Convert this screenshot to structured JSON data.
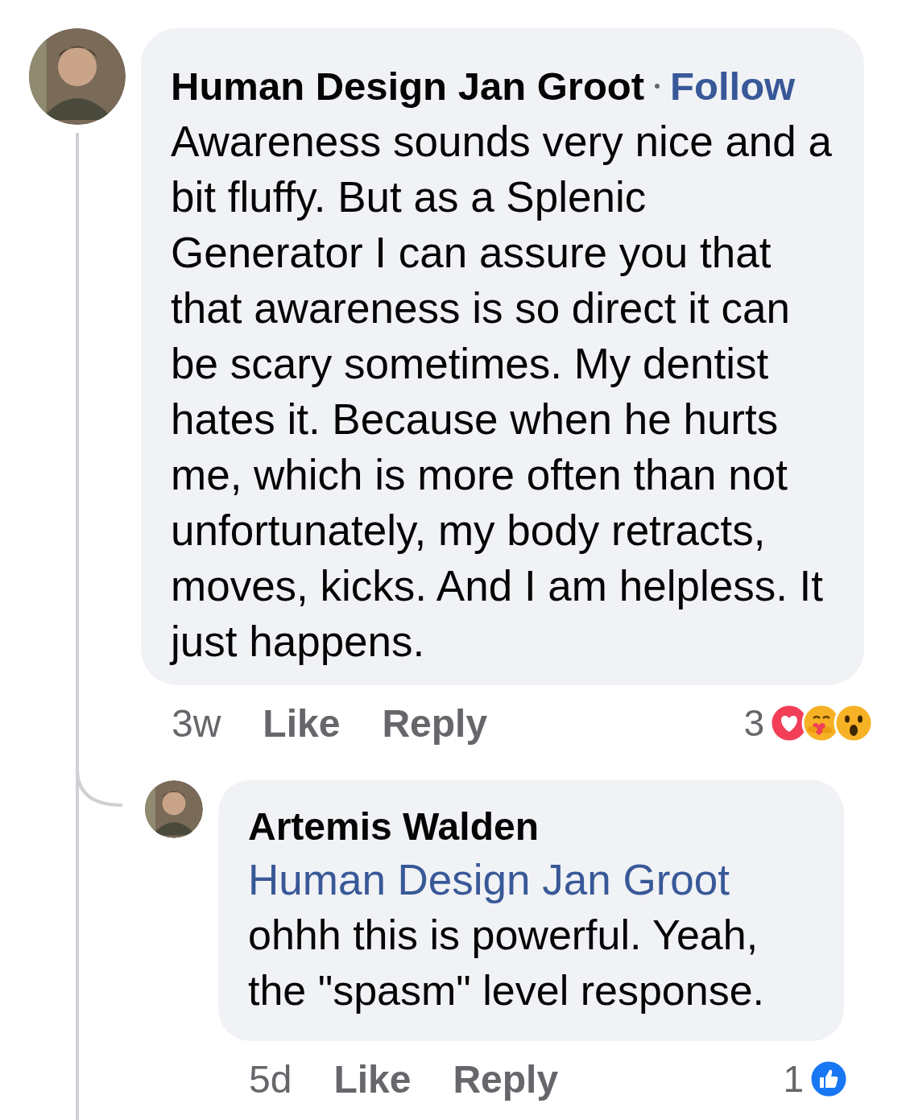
{
  "comments": [
    {
      "author": "Human Design Jan Groot",
      "follow": "Follow",
      "text": "Awareness sounds very nice and a bit fluffy. But as a Splenic Generator I can assure you that that awareness is so direct it can be scary sometimes. My dentist hates it. Because when he hurts me, which is more often than not unfortunately, my body retracts, moves, kicks. And I am helpless. It just happens.",
      "time": "3w",
      "like": "Like",
      "reply": "Reply",
      "reaction_count": "3",
      "reactions": [
        {
          "kind": "love"
        },
        {
          "kind": "care"
        },
        {
          "kind": "wow"
        }
      ],
      "children": [
        {
          "author": "Artemis Walden",
          "mention": "Human Design Jan Groot",
          "text": "ohhh this is powerful. Yeah, the \"spasm\" level response.",
          "time": "5d",
          "like": "Like",
          "reply": "Reply",
          "reaction_count": "1",
          "reactions": [
            {
              "kind": "like"
            }
          ]
        }
      ]
    }
  ]
}
